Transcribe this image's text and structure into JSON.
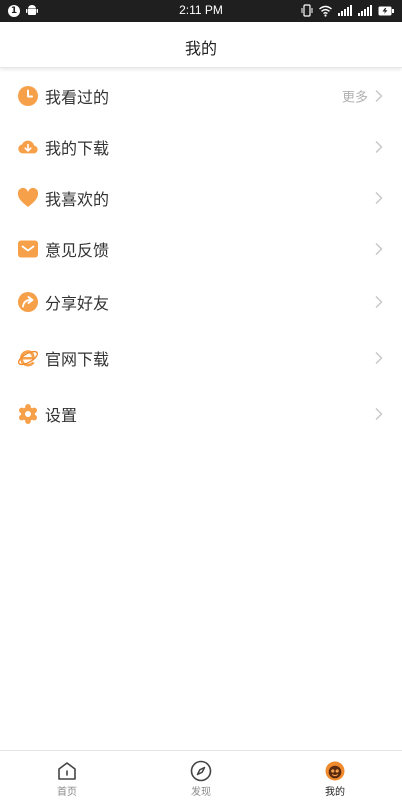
{
  "status_bar": {
    "notification_badge": "1",
    "time": "2:11 PM"
  },
  "header": {
    "title": "我的"
  },
  "menu": {
    "items": [
      {
        "label": "我看过的",
        "more": "更多",
        "icon": "clock-icon"
      },
      {
        "label": "我的下载",
        "icon": "cloud-download-icon"
      },
      {
        "label": "我喜欢的",
        "icon": "heart-icon"
      },
      {
        "label": "意见反馈",
        "icon": "mail-icon"
      },
      {
        "label": "分享好友",
        "icon": "share-icon"
      },
      {
        "label": "官网下载",
        "icon": "browser-e-icon"
      },
      {
        "label": "设置",
        "icon": "gear-icon"
      }
    ]
  },
  "bottom_nav": {
    "tabs": [
      {
        "label": "首页",
        "icon": "home-icon"
      },
      {
        "label": "发现",
        "icon": "compass-icon"
      },
      {
        "label": "我的",
        "icon": "profile-icon"
      }
    ],
    "active_index": 2
  },
  "colors": {
    "accent": "#F7A04A",
    "accent_dark": "#F08A2C",
    "chevron": "#c8c8c8"
  }
}
